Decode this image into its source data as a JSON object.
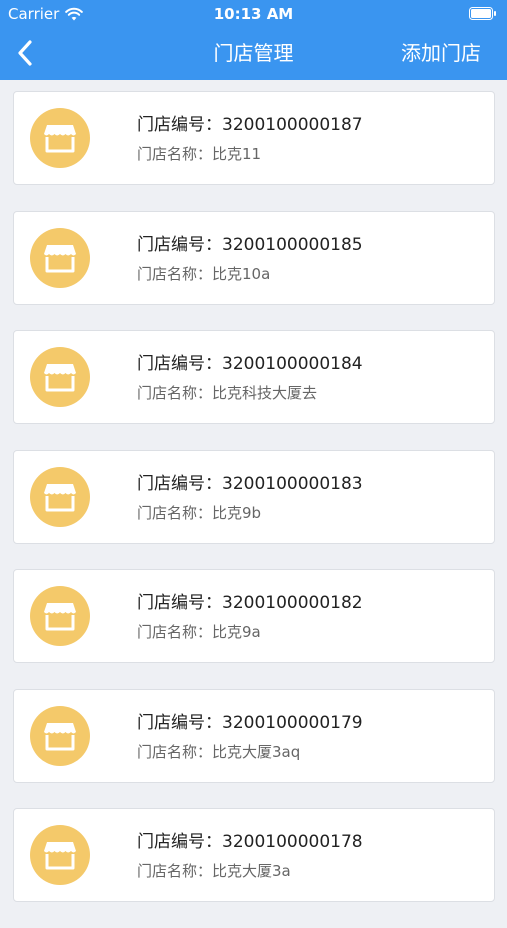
{
  "status_bar": {
    "carrier": "Carrier",
    "time": "10:13 AM"
  },
  "nav": {
    "title": "门店管理",
    "add_label": "添加门店"
  },
  "labels": {
    "code_label": "门店编号：",
    "name_label": "门店名称："
  },
  "colors": {
    "header": "#3a95f0",
    "avatar": "#f4c96a",
    "background": "#eef0f4"
  },
  "stores": [
    {
      "code": "3200100000187",
      "name": "比克11"
    },
    {
      "code": "3200100000185",
      "name": "比克10a"
    },
    {
      "code": "3200100000184",
      "name": "比克科技大厦去"
    },
    {
      "code": "3200100000183",
      "name": "比克9b"
    },
    {
      "code": "3200100000182",
      "name": "比克9a"
    },
    {
      "code": "3200100000179",
      "name": "比克大厦3aq"
    },
    {
      "code": "3200100000178",
      "name": "比克大厦3a"
    }
  ]
}
